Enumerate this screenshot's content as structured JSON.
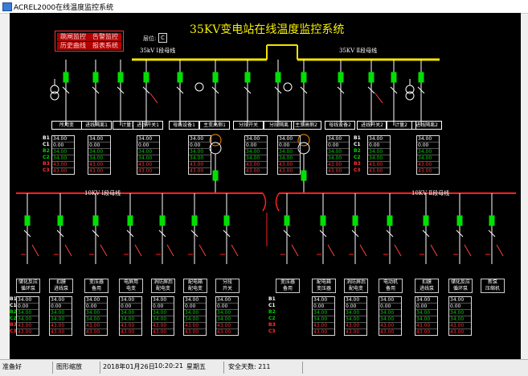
{
  "window": {
    "title": "ACREL2000在线温度监控系统"
  },
  "system_title": "35KV变电站在线温度监控系统",
  "alarm_buttons": [
    {
      "label": "跳闸监控",
      "name": "trip-monitor-button"
    },
    {
      "label": "告警监控",
      "name": "alarm-monitor-button"
    },
    {
      "label": "历史曲线",
      "name": "history-curve-button"
    },
    {
      "label": "报表系统",
      "name": "report-system-button"
    }
  ],
  "position": {
    "label": "层位:",
    "value": "C"
  },
  "bus_labels": {
    "bus35_1": "35kV Ⅰ段母线",
    "bus35_2": "35KV Ⅱ段母线",
    "bus10_1": "10KV Ⅰ段母线",
    "bus10_2": "10KV Ⅱ段母线"
  },
  "top_devices": [
    {
      "name": "所用变"
    },
    {
      "name": "进线隔离1"
    },
    {
      "name": "计量1"
    },
    {
      "name": "进线开关1"
    },
    {
      "name": "母线设备1"
    },
    {
      "name": "主变高侧1"
    },
    {
      "name": "分段开关"
    },
    {
      "name": "分段隔离"
    },
    {
      "name": "主变高侧2"
    },
    {
      "name": "母线设备2"
    },
    {
      "name": "进线开关2"
    },
    {
      "name": "计量2"
    },
    {
      "name": "进线隔离2"
    }
  ],
  "top_tables": [
    [
      "34.00",
      "0.00",
      "34.00",
      "34.00",
      "43.00",
      "43.00"
    ],
    [
      "34.00",
      "0.00",
      "34.00",
      "34.00",
      "43.00",
      "43.00"
    ],
    [
      "34.00",
      "0.00",
      "34.00",
      "34.00",
      "43.00",
      "43.00"
    ],
    [
      "34.00",
      "0.00",
      "34.00",
      "34.00",
      "43.00",
      "43.00"
    ],
    [
      "34.00",
      "0.00",
      "34.00",
      "34.00",
      "43.00",
      "43.00"
    ],
    [
      "34.00",
      "0.00",
      "34.00",
      "34.00",
      "43.00",
      "43.00"
    ],
    [
      "34.00",
      "0.00",
      "34.00",
      "34.00",
      "43.00",
      "43.00"
    ],
    [
      "34.00",
      "0.00",
      "34.00",
      "34.00",
      "43.00",
      "43.00"
    ],
    [
      "34.00",
      "0.00",
      "34.00",
      "34.00",
      "43.00",
      "43.00"
    ]
  ],
  "phases": [
    {
      "label": "B1",
      "color": "#ffffff"
    },
    {
      "label": "C1",
      "color": "#ffffff"
    },
    {
      "label": "B2",
      "color": "#00d000"
    },
    {
      "label": "C2",
      "color": "#00d000"
    },
    {
      "label": "B3",
      "color": "#ff3030"
    },
    {
      "label": "C3",
      "color": "#ff3030"
    }
  ],
  "bottom_devices": [
    {
      "l1": "储化反应",
      "l2": "循环泵"
    },
    {
      "l1": "扣膜",
      "l2": "进线泵"
    },
    {
      "l1": "变压器",
      "l2": "备用"
    },
    {
      "l1": "电屏用",
      "l2": "电变"
    },
    {
      "l1": "消防屏后",
      "l2": "配电变"
    },
    {
      "l1": "配电箱",
      "l2": "配电变"
    },
    {
      "l1": "分段",
      "l2": "开关"
    },
    {
      "l1": "变压器",
      "l2": "备用"
    },
    {
      "l1": "配电箱",
      "l2": "变压器"
    },
    {
      "l1": "消防屏后",
      "l2": "配电变"
    },
    {
      "l1": "电动机",
      "l2": "备用"
    },
    {
      "l1": "扣膜",
      "l2": "进线泵"
    },
    {
      "l1": "储化反应",
      "l2": "循环泵"
    },
    {
      "l1": "新泵",
      "l2": "压缩机"
    }
  ],
  "bottom_tables": [
    [
      "34.00",
      "0.00",
      "34.00",
      "34.00",
      "43.00",
      "43.00"
    ],
    [
      "34.00",
      "0.00",
      "34.00",
      "34.00",
      "43.00",
      "43.00"
    ],
    [
      "34.00",
      "0.00",
      "34.00",
      "34.00",
      "43.00",
      "43.00"
    ],
    [
      "34.00",
      "0.00",
      "34.00",
      "34.00",
      "43.00",
      "43.00"
    ],
    [
      "34.00",
      "0.00",
      "34.00",
      "34.00",
      "43.00",
      "43.00"
    ],
    [
      "34.00",
      "0.00",
      "34.00",
      "34.00",
      "43.00",
      "43.00"
    ],
    [
      "34.00",
      "0.00",
      "34.00",
      "34.00",
      "43.00",
      "43.00"
    ],
    [
      "34.00",
      "0.00",
      "34.00",
      "34.00",
      "43.00",
      "43.00"
    ],
    [
      "34.00",
      "0.00",
      "34.00",
      "34.00",
      "43.00",
      "43.00"
    ],
    [
      "34.00",
      "0.00",
      "34.00",
      "34.00",
      "43.00",
      "43.00"
    ],
    [
      "34.00",
      "0.00",
      "34.00",
      "34.00",
      "43.00",
      "43.00"
    ],
    [
      "34.00",
      "0.00",
      "34.00",
      "34.00",
      "43.00",
      "43.00"
    ]
  ],
  "status": {
    "ready": "准备好",
    "zoom": "图形缩放",
    "datetime": "2018年01月26日",
    "time": "10:20:21",
    "weekday": "星期五",
    "safe_days": "安全天数: 211"
  },
  "colors": {
    "bus35": "#f2e300",
    "bus10": "#ff2020",
    "breaker": "#00e000",
    "wire": "#ffffff"
  }
}
